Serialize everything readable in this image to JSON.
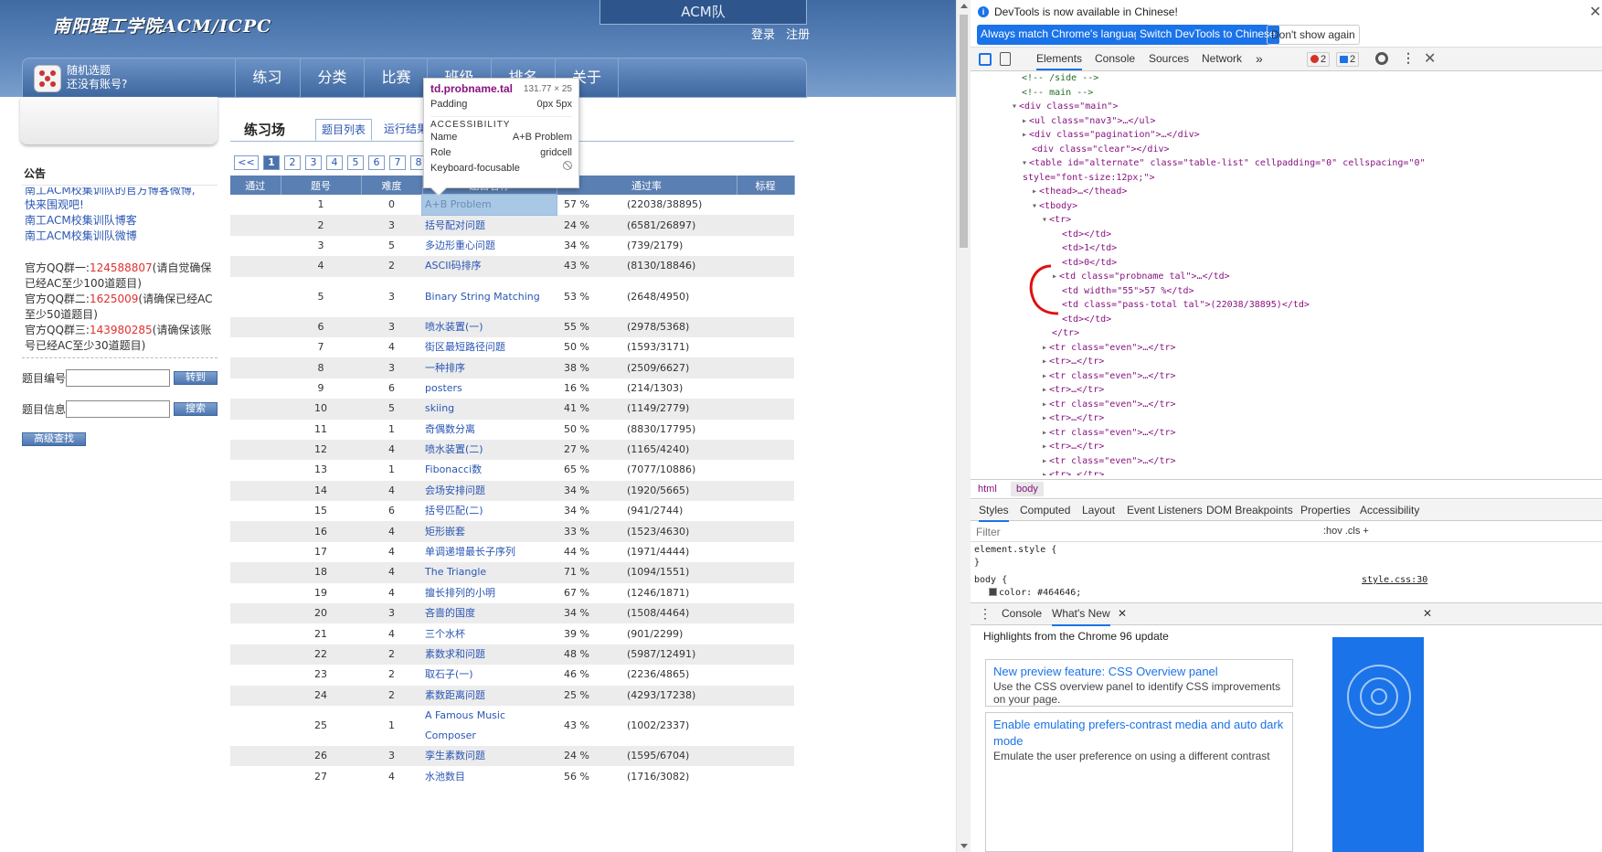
{
  "site": {
    "logo_text": "南阳理工学院ACM/ICPC",
    "team_box": "ACM队",
    "login": "登录",
    "register": "注册",
    "random_pick": "随机选题",
    "no_account": "还没有账号?",
    "nav": [
      "练习",
      "分类",
      "比赛",
      "班级",
      "排名",
      "关于"
    ]
  },
  "sidebar": {
    "notice_title": "公告",
    "notice_links": [
      "南工ACM校集训队的官方博客微博,",
      "快来围观吧!",
      "南工ACM校集训队博客",
      "南工ACM校集训队微博"
    ],
    "qq_groups": [
      {
        "label": "官方QQ群一:",
        "number": "124588807",
        "note": "(请自觉确保已经AC至少100道题目)"
      },
      {
        "label": "官方QQ群二:",
        "number": "1625009",
        "note": "(请确保已经AC至少50道题目)"
      },
      {
        "label": "官方QQ群三:",
        "number": "143980285",
        "note": "(请确保该账号已经AC至少30道题目)"
      }
    ],
    "problem_id_label": "题目编号",
    "goto_button": "转到",
    "problem_info_label": "题目信息",
    "search_button": "搜索",
    "advanced_button": "高级查找"
  },
  "main": {
    "title": "练习场",
    "tab_list": "题目列表",
    "tab_status": "运行结果",
    "pager": [
      "<<",
      "1",
      "2",
      "3",
      "4",
      "5",
      "6",
      "7",
      "8"
    ],
    "headers": [
      "通过",
      "题号",
      "难度",
      "题目名称",
      "通过率",
      "",
      "标程"
    ],
    "rows": [
      {
        "id": "1",
        "level": "0",
        "name": "A+B Problem",
        "rate": "57 %",
        "total": "(22038/38895)"
      },
      {
        "id": "2",
        "level": "3",
        "name": "括号配对问题",
        "rate": "24 %",
        "total": "(6581/26897)"
      },
      {
        "id": "3",
        "level": "5",
        "name": "多边形重心问题",
        "rate": "34 %",
        "total": "(739/2179)"
      },
      {
        "id": "4",
        "level": "2",
        "name": "ASCII码排序",
        "rate": "43 %",
        "total": "(8130/18846)"
      },
      {
        "id": "5",
        "level": "3",
        "name": "Binary String Matching",
        "rate": "53 %",
        "total": "(2648/4950)"
      },
      {
        "id": "6",
        "level": "3",
        "name": "喷水装置(一)",
        "rate": "55 %",
        "total": "(2978/5368)"
      },
      {
        "id": "7",
        "level": "4",
        "name": "街区最短路径问题",
        "rate": "50 %",
        "total": "(1593/3171)"
      },
      {
        "id": "8",
        "level": "3",
        "name": "一种排序",
        "rate": "38 %",
        "total": "(2509/6627)"
      },
      {
        "id": "9",
        "level": "6",
        "name": "posters",
        "rate": "16 %",
        "total": "(214/1303)"
      },
      {
        "id": "10",
        "level": "5",
        "name": "skiing",
        "rate": "41 %",
        "total": "(1149/2779)"
      },
      {
        "id": "11",
        "level": "1",
        "name": "奇偶数分离",
        "rate": "50 %",
        "total": "(8830/17795)"
      },
      {
        "id": "12",
        "level": "4",
        "name": "喷水装置(二)",
        "rate": "27 %",
        "total": "(1165/4240)"
      },
      {
        "id": "13",
        "level": "1",
        "name": "Fibonacci数",
        "rate": "65 %",
        "total": "(7077/10886)"
      },
      {
        "id": "14",
        "level": "4",
        "name": "会场安排问题",
        "rate": "34 %",
        "total": "(1920/5665)"
      },
      {
        "id": "15",
        "level": "6",
        "name": "括号匹配(二)",
        "rate": "34 %",
        "total": "(941/2744)"
      },
      {
        "id": "16",
        "level": "4",
        "name": "矩形嵌套",
        "rate": "33 %",
        "total": "(1523/4630)"
      },
      {
        "id": "17",
        "level": "4",
        "name": "单调递增最长子序列",
        "rate": "44 %",
        "total": "(1971/4444)"
      },
      {
        "id": "18",
        "level": "4",
        "name": "The Triangle",
        "rate": "71 %",
        "total": "(1094/1551)"
      },
      {
        "id": "19",
        "level": "4",
        "name": "擅长排列的小明",
        "rate": "67 %",
        "total": "(1246/1871)"
      },
      {
        "id": "20",
        "level": "3",
        "name": "吝啬的国度",
        "rate": "34 %",
        "total": "(1508/4464)"
      },
      {
        "id": "21",
        "level": "4",
        "name": "三个水杯",
        "rate": "39 %",
        "total": "(901/2299)"
      },
      {
        "id": "22",
        "level": "2",
        "name": "素数求和问题",
        "rate": "48 %",
        "total": "(5987/12491)"
      },
      {
        "id": "23",
        "level": "2",
        "name": "取石子(一)",
        "rate": "46 %",
        "total": "(2236/4865)"
      },
      {
        "id": "24",
        "level": "2",
        "name": "素数距离问题",
        "rate": "25 %",
        "total": "(4293/17238)"
      },
      {
        "id": "25",
        "level": "1",
        "name": "A Famous Music Composer",
        "rate": "43 %",
        "total": "(1002/2337)"
      },
      {
        "id": "26",
        "level": "3",
        "name": "孪生素数问题",
        "rate": "24 %",
        "total": "(1595/6704)"
      },
      {
        "id": "27",
        "level": "4",
        "name": "水池数目",
        "rate": "56 %",
        "total": "(1716/3082)"
      }
    ]
  },
  "inspect_tooltip": {
    "selector": "td.probname.tal",
    "size": "131.77 × 25",
    "padding_label": "Padding",
    "padding_value": "0px 5px",
    "section": "ACCESSIBILITY",
    "name_label": "Name",
    "name_value": "A+B Problem",
    "role_label": "Role",
    "role_value": "gridcell",
    "focus_label": "Keyboard-focusable"
  },
  "devtools": {
    "banner_text": "DevTools is now available in Chinese!",
    "btn_match": "Always match Chrome's language",
    "btn_switch": "Switch DevTools to Chinese",
    "btn_dismiss": "Don't show again",
    "tabs": [
      "Elements",
      "Console",
      "Sources",
      "Network"
    ],
    "more_tabs": "»",
    "errors": "2",
    "messages": "2",
    "dom_lines": [
      {
        "indent": 0,
        "cls": "dom-comment",
        "text": "<!-- /side -->"
      },
      {
        "indent": 0,
        "cls": "dom-comment",
        "text": "<!-- main -->"
      },
      {
        "indent": 0,
        "tri": "▾",
        "text": "<div class=\"main\">"
      },
      {
        "indent": 1,
        "tri": "▸",
        "text": "<ul class=\"nav3\">…</ul>"
      },
      {
        "indent": 1,
        "tri": "▸",
        "text": "<div class=\"pagination\">…</div>"
      },
      {
        "indent": 1,
        "text": "<div class=\"clear\"></div>"
      },
      {
        "indent": 1,
        "tri": "▾",
        "text": "<table id=\"alternate\" class=\"table-list\" cellpadding=\"0\" cellspacing=\"0\""
      },
      {
        "indent": 0,
        "text": "style=\"font-size:12px;\">"
      },
      {
        "indent": 2,
        "tri": "▸",
        "text": "<thead>…</thead>"
      },
      {
        "indent": 2,
        "tri": "▾",
        "text": "<tbody>"
      },
      {
        "indent": 3,
        "tri": "▾",
        "text": "<tr>"
      },
      {
        "indent": 4,
        "text": "<td></td>"
      },
      {
        "indent": 4,
        "text": "<td>1</td>"
      },
      {
        "indent": 4,
        "text": "<td>0</td>"
      },
      {
        "indent": 4,
        "tri": "▸",
        "text": "<td class=\"probname tal\">…</td>"
      },
      {
        "indent": 4,
        "text": "<td width=\"55\">57 %</td>"
      },
      {
        "indent": 4,
        "text": "<td class=\"pass-total tal\">(22038/38895)</td>"
      },
      {
        "indent": 4,
        "text": "<td></td>"
      },
      {
        "indent": 3,
        "text": "</tr>"
      },
      {
        "indent": 3,
        "tri": "▸",
        "text": "<tr class=\"even\">…</tr>"
      },
      {
        "indent": 3,
        "tri": "▸",
        "text": "<tr>…</tr>"
      },
      {
        "indent": 3,
        "tri": "▸",
        "text": "<tr class=\"even\">…</tr>"
      },
      {
        "indent": 3,
        "tri": "▸",
        "text": "<tr>…</tr>"
      },
      {
        "indent": 3,
        "tri": "▸",
        "text": "<tr class=\"even\">…</tr>"
      },
      {
        "indent": 3,
        "tri": "▸",
        "text": "<tr>…</tr>"
      },
      {
        "indent": 3,
        "tri": "▸",
        "text": "<tr class=\"even\">…</tr>"
      },
      {
        "indent": 3,
        "tri": "▸",
        "text": "<tr>…</tr>"
      },
      {
        "indent": 3,
        "tri": "▸",
        "text": "<tr class=\"even\">…</tr>"
      },
      {
        "indent": 3,
        "tri": "▸",
        "text": "<tr>…</tr>"
      }
    ],
    "crumbs": [
      "html",
      "body"
    ],
    "style_tabs": [
      "Styles",
      "Computed",
      "Layout",
      "Event Listeners",
      "DOM Breakpoints",
      "Properties",
      "Accessibility"
    ],
    "filter_placeholder": "Filter",
    "filter_right": ":hov  .cls  +",
    "css_lines": [
      "element.style {",
      "}",
      "body {",
      "color: #464646;"
    ],
    "css_source": "style.css:30",
    "drawer_tabs": [
      "Console",
      "What's New"
    ],
    "whats_new_heading": "Highlights from the Chrome 96 update",
    "cards": [
      {
        "title": "New preview feature: CSS Overview panel",
        "desc": "Use the CSS overview panel to identify CSS improvements on your page."
      },
      {
        "title": "Enable emulating prefers-contrast media and auto dark mode",
        "desc": "Emulate the user preference on using a different contrast"
      }
    ]
  },
  "colors": {
    "accent": "#1a73e8",
    "site_blue": "#4a72ab",
    "qq_red": "#e03030",
    "tag": "#881280"
  }
}
